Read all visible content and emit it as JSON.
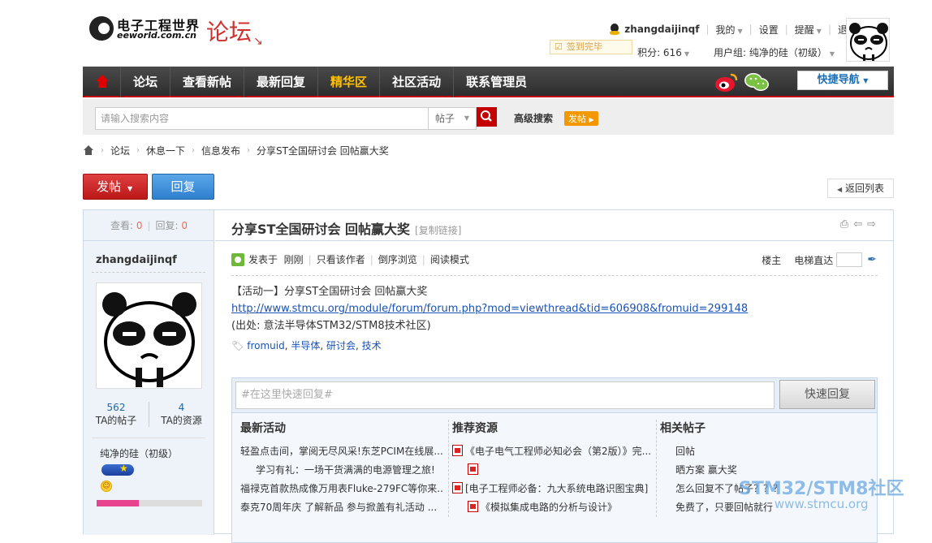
{
  "header": {
    "logo_cn": "电子工程世界",
    "logo_en": "eeworld.com.cn",
    "forum_title": "论坛",
    "username": "zhangdaijinqf",
    "menu": [
      "我的",
      "设置",
      "提醒",
      "退出"
    ],
    "signin_label": "签到完毕",
    "points": "积分: 616",
    "user_group": "用户组: 纯净的硅（初级）"
  },
  "nav": {
    "items": [
      "论坛",
      "查看新帖",
      "最新回复",
      "精华区",
      "社区活动",
      "联系管理员"
    ],
    "active": "精华区",
    "quick_nav": "快捷导航"
  },
  "search": {
    "placeholder": "请输入搜索内容",
    "type": "帖子",
    "advanced": "高级搜索",
    "advanced_tag": "发帖"
  },
  "breadcrumb": [
    "论坛",
    "休息一下",
    "信息发布",
    "分享ST全国研讨会 回帖赢大奖"
  ],
  "actions": {
    "post": "发帖",
    "reply": "回复",
    "back": "返回列表"
  },
  "stats": {
    "views_label": "查看:",
    "views": "0",
    "replies_label": "回复:",
    "replies": "0"
  },
  "author": {
    "name": "zhangdaijinqf",
    "posts": "562",
    "posts_label": "TA的帖子",
    "resources": "4",
    "resources_label": "TA的资源",
    "group": "纯净的硅（初级）",
    "progress": 0.4
  },
  "post": {
    "title": "分享ST全国研讨会 回帖赢大奖",
    "copy_link": "[复制链接]",
    "posted_at_label": "发表于",
    "posted_at": "刚刚",
    "only_author": "只看该作者",
    "reverse": "倒序浏览",
    "read_mode": "阅读模式",
    "floor_owner": "楼主",
    "elevator": "电梯直达",
    "line1": "【活动一】分享ST全国研讨会  回帖赢大奖",
    "url": "http://www.stmcu.org/module/forum/forum.php?mod=viewthread&tid=606908&fromuid=299148",
    "source": "(出处: 意法半导体STM32/STM8技术社区)",
    "tags": [
      "fromuid",
      "半导体",
      "研讨会",
      "技术"
    ]
  },
  "quick_reply": {
    "placeholder": "#在这里快速回复#",
    "submit": "快速回复"
  },
  "lists": {
    "latest": {
      "title": "最新活动",
      "items": [
        "轻盈点击间，掌阅无尽风采!东芝PCIM在线展...",
        "学习有礼：一场干货满满的电源管理之旅!",
        "福禄克首款热成像万用表Fluke-279FC等你来...",
        "泰克70周年庆 了解新品 参与掀盖有礼活动 ..."
      ]
    },
    "resources": {
      "title": "推荐资源",
      "items": [
        "《电子电气工程师必知必会（第2版）》完...",
        "",
        "[电子工程师必备：九大系统电路识图宝典]",
        "《模拟集成电路的分析与设计》"
      ]
    },
    "related": {
      "title": "相关帖子",
      "items": [
        "回帖",
        "晒方案 赢大奖",
        "怎么回复不了帖子？？？",
        "免费了，只要回帖就行"
      ]
    }
  },
  "watermark": {
    "line1": "STM32/STM8社区",
    "line2": "www.stmcu.org"
  }
}
